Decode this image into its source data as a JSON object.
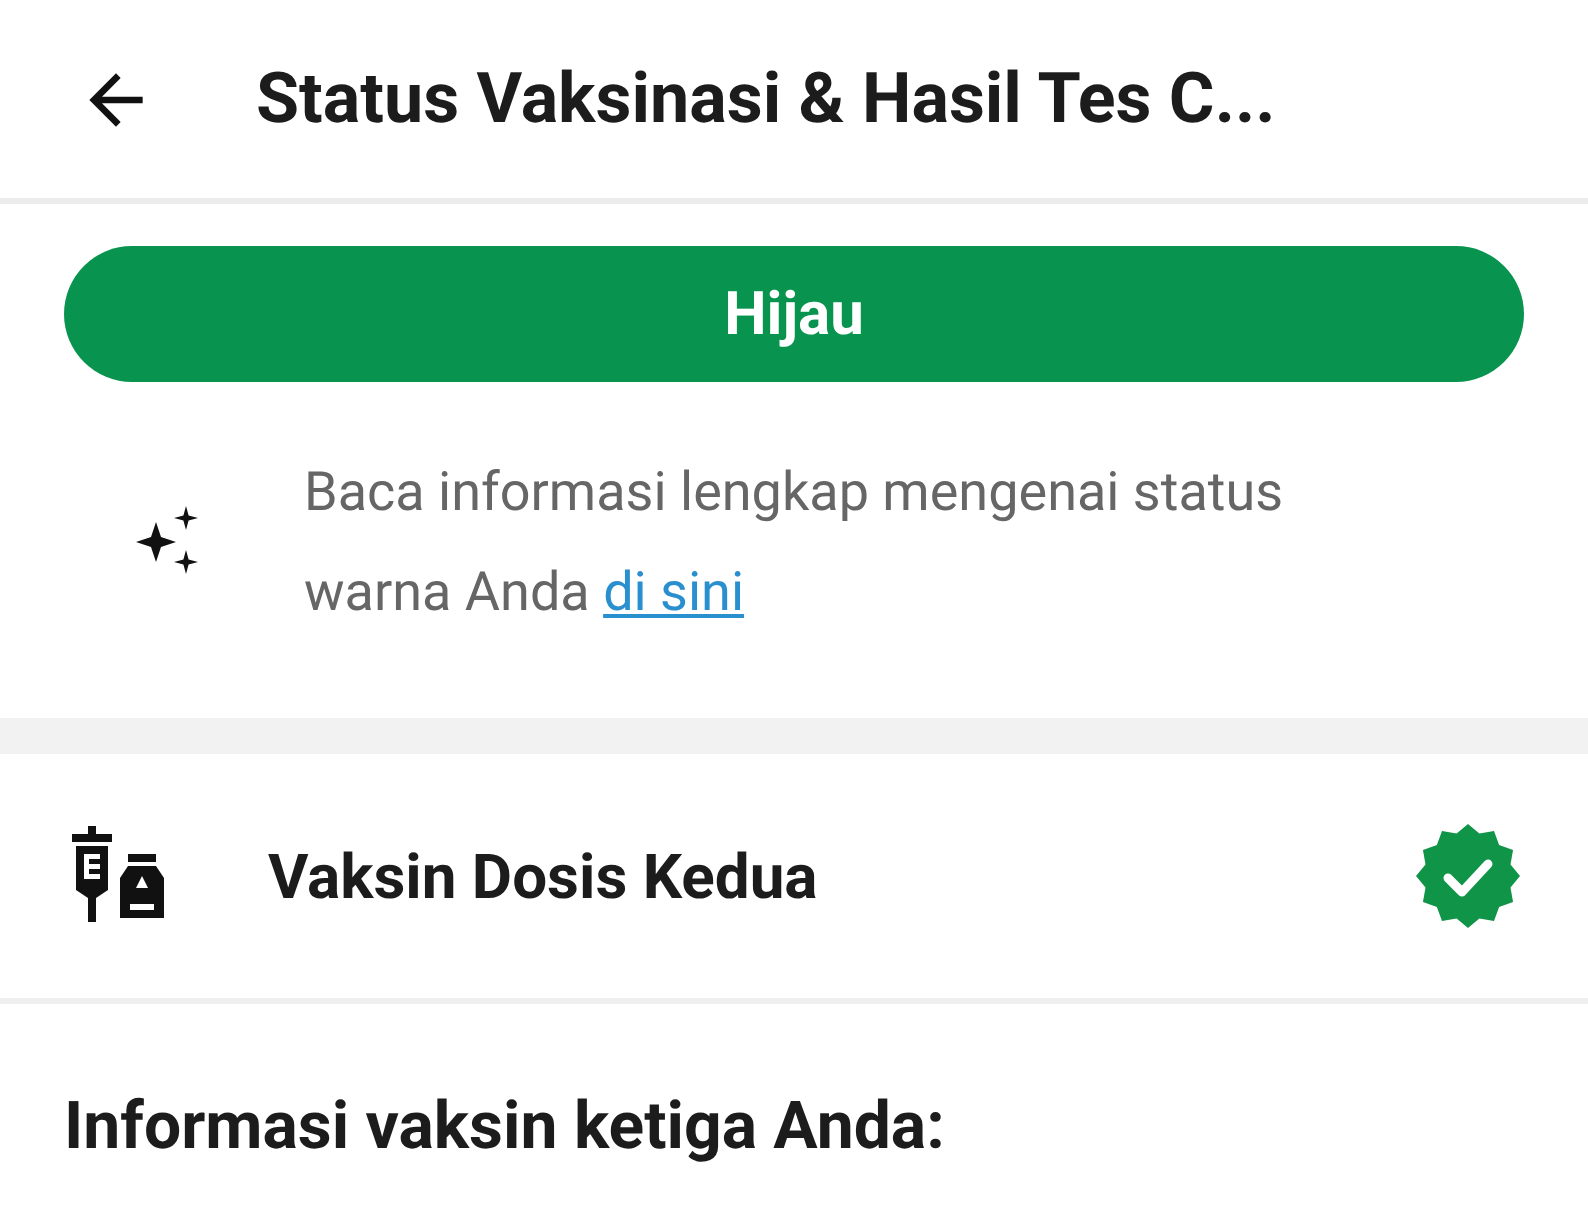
{
  "header": {
    "title": "Status Vaksinasi & Hasil Tes C..."
  },
  "status": {
    "label": "Hijau",
    "color": "#08934f"
  },
  "info": {
    "text": "Baca informasi lengkap mengenai status warna Anda",
    "link": "di sini"
  },
  "vaccine": {
    "label": "Vaksin Dosis Kedua",
    "verified": true
  },
  "section_heading": "Informasi vaksin ketiga Anda:"
}
